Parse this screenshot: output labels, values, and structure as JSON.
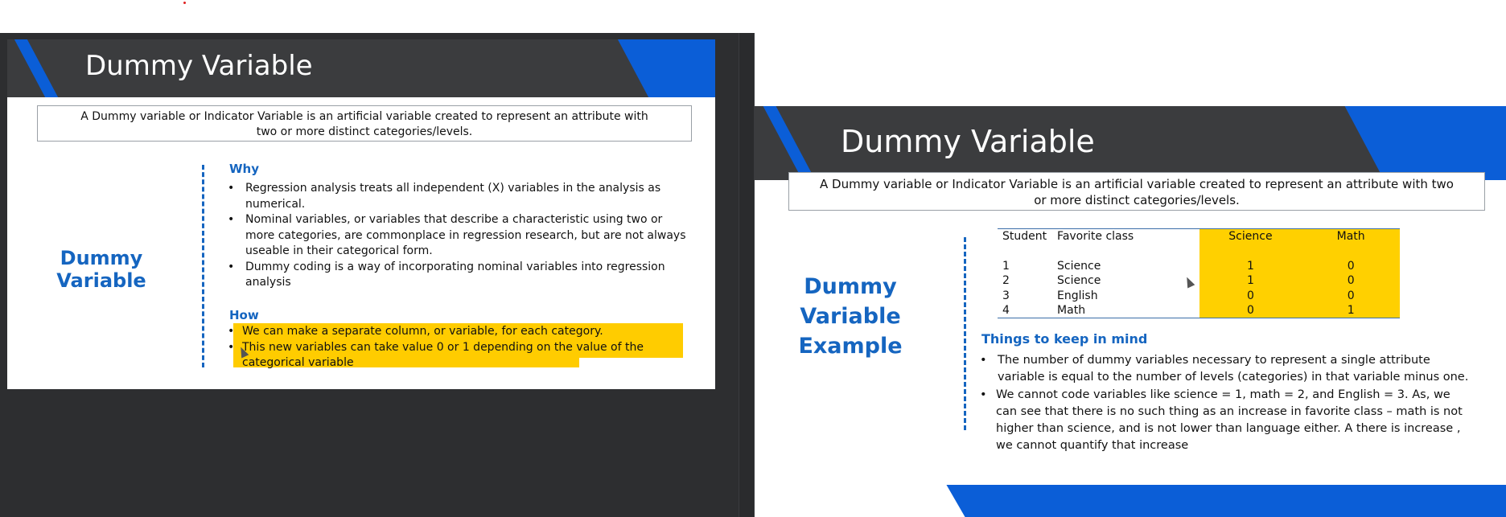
{
  "slide_left": {
    "title": "Dummy Variable",
    "definition": "A Dummy variable or Indicator Variable is an artificial variable created to represent an attribute with two or more distinct categories/levels.",
    "side_label": "Dummy Variable",
    "why_heading": "Why",
    "why_bullets": [
      "Regression analysis treats all independent (X) variables in the analysis as numerical.",
      "Nominal variables, or variables that describe a characteristic using two or more categories, are commonplace in regression research, but are not always useable in their categorical form.",
      "Dummy coding is a way of incorporating nominal variables into regression analysis"
    ],
    "how_heading": "How",
    "how_bullets": [
      "We can make a separate column, or variable, for each category.",
      "This new variables can take value 0 or 1 depending on the value of the categorical variable"
    ],
    "highlight_color": "#ffcc00"
  },
  "slide_right": {
    "title": "Dummy Variable",
    "definition": "A Dummy variable or Indicator Variable is an artificial variable created to represent an attribute with two or more distinct categories/levels.",
    "side_label_line1": "Dummy Variable",
    "side_label_line2": "Example",
    "table": {
      "headers": [
        "Student",
        "Favorite class",
        "Science",
        "Math"
      ],
      "rows": [
        [
          "1",
          "Science",
          "1",
          "0"
        ],
        [
          "2",
          "Science",
          "1",
          "0"
        ],
        [
          "3",
          "English",
          "0",
          "0"
        ],
        [
          "4",
          "Math",
          "0",
          "1"
        ]
      ]
    },
    "keep_heading": "Things to keep in mind",
    "keep_bullets": [
      "The number of dummy variables necessary to represent a single attribute variable is equal to the number of levels (categories) in that variable minus one.",
      "We cannot code variables like science = 1, math = 2, and English = 3. As, we can see that there is no such thing as an increase in favorite class – math is not higher than science, and is not lower than language either. A there is increase , we cannot quantify that increase"
    ]
  },
  "colors": {
    "accent_blue": "#0b5ed7",
    "label_blue": "#1565c0",
    "header_dark": "#3b3c3e",
    "table_yellow": "#ffd000"
  }
}
